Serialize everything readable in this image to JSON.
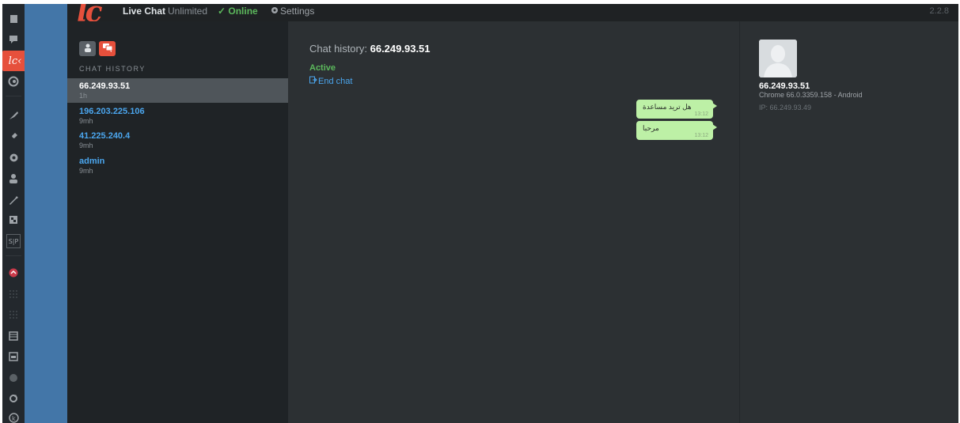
{
  "app": {
    "logo": "lc",
    "product_name": "Live Chat",
    "edition": "Unlimited",
    "status": "✓ Online",
    "settings_label": "Settings",
    "version": "2.2.8"
  },
  "wp_sidebar": {
    "icons": [
      "dashboard-icon",
      "comments-icon",
      "live-chat-icon",
      "contact-icon",
      "appearance-icon",
      "plugins-icon",
      "settings-icon",
      "users-icon",
      "tools-icon",
      "media-icon",
      "plugin-sp-icon",
      "red-plugin-icon",
      "grid-icon",
      "grid-icon",
      "table-icon",
      "table-icon",
      "circle-icon",
      "refresh-icon",
      "kirki-icon"
    ],
    "sp_label": "S|P"
  },
  "history": {
    "label": "CHAT HISTORY",
    "items": [
      {
        "name": "66.249.93.51",
        "time": "1h",
        "selected": true
      },
      {
        "name": "196.203.225.106",
        "time": "9mh",
        "selected": false
      },
      {
        "name": "41.225.240.4",
        "time": "9mh",
        "selected": false
      },
      {
        "name": "admin",
        "time": "9mh",
        "selected": false
      }
    ]
  },
  "chat": {
    "title_prefix": "Chat history:",
    "title_ip": "66.249.93.51",
    "status": "Active",
    "end_chat": "End chat",
    "messages": [
      {
        "text": "هل تريد مساعدة",
        "time": "13:12"
      },
      {
        "text": "مرحبا",
        "time": "13:12"
      }
    ]
  },
  "visitor": {
    "name": "66.249.93.51",
    "browser": "Chrome 66.0.3359.158 - Android",
    "ip": "IP: 66.249.93.49"
  },
  "colors": {
    "accent": "#e6503c",
    "online": "#5cb85c",
    "link": "#4ba6ee",
    "bubble": "#bdf0a6"
  }
}
